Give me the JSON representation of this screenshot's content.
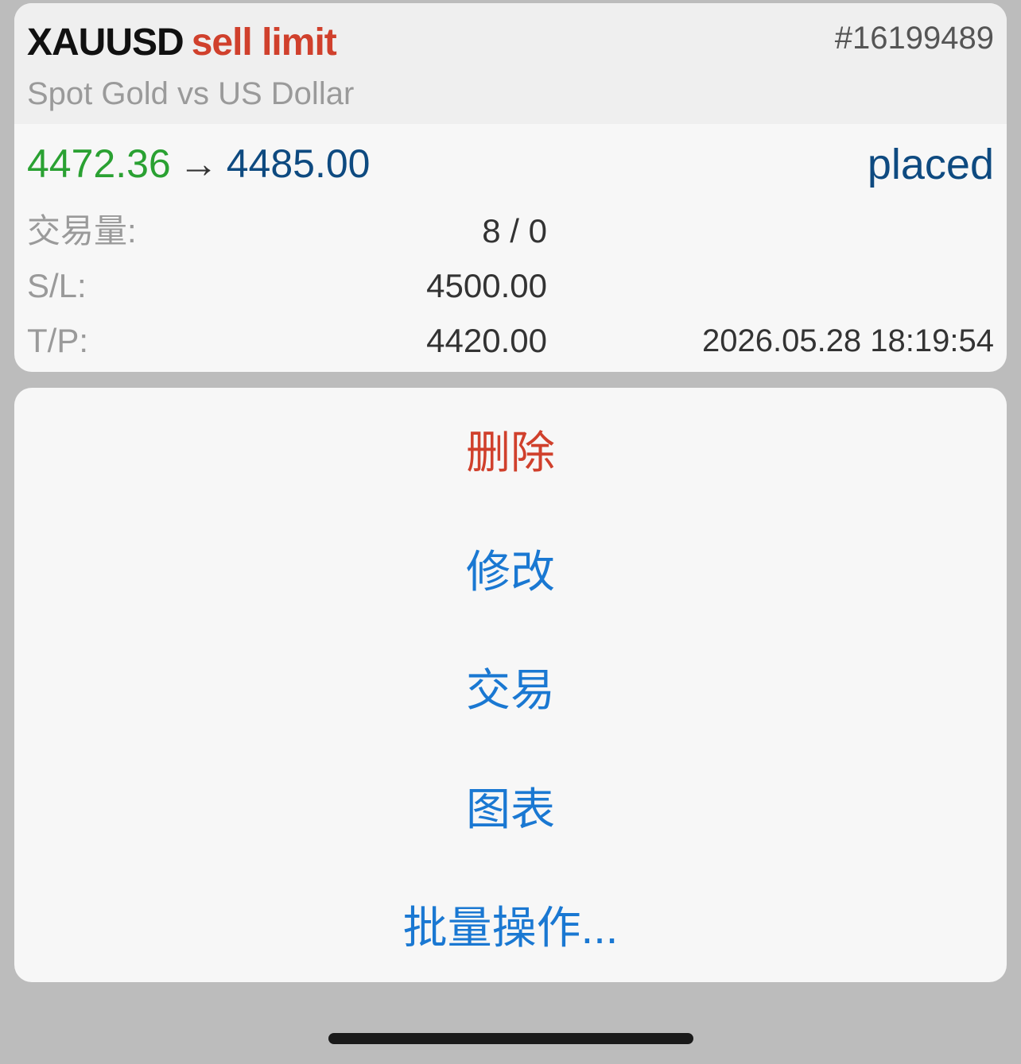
{
  "order": {
    "symbol": "XAUUSD",
    "type": "sell limit",
    "ticket": "#16199489",
    "description": "Spot Gold vs US Dollar",
    "open_price": "4472.36",
    "arrow": "→",
    "target_price": "4485.00",
    "status": "placed",
    "volume_label": "交易量:",
    "volume_value": "8 / 0",
    "sl_label": "S/L:",
    "sl_value": "4500.00",
    "tp_label": "T/P:",
    "tp_value": "4420.00",
    "time": "2026.05.28 18:19:54"
  },
  "actions": {
    "delete": "删除",
    "modify": "修改",
    "trade": "交易",
    "chart": "图表",
    "bulk": "批量操作..."
  },
  "colors": {
    "sell": "#d0402c",
    "open_price": "#2aa132",
    "target_price": "#0e4a80",
    "action_blue": "#1a78d2",
    "destructive": "#d0402c"
  }
}
